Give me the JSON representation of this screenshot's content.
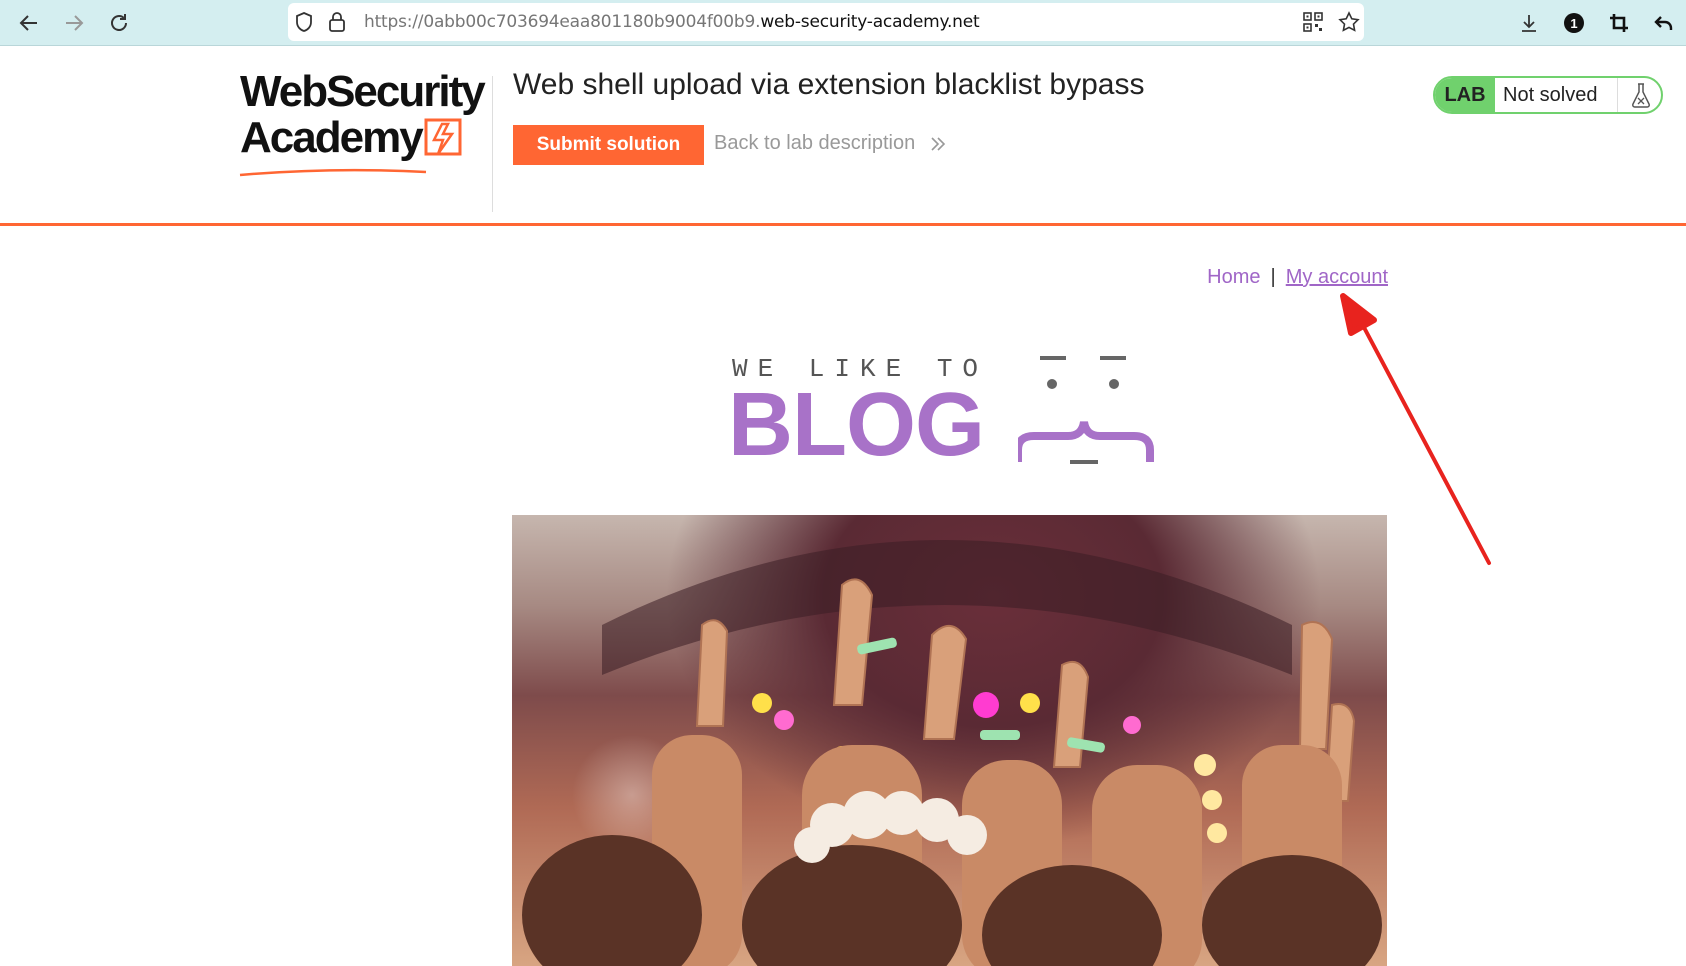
{
  "browser": {
    "url_prefix": "https://0abb00c703694eaa801180b9004f00b9.",
    "url_domain": "web-security-academy.net"
  },
  "lab": {
    "logo_line1": "WebSecurity",
    "logo_line2": "Academy",
    "title": "Web shell upload via extension blacklist bypass",
    "submit_label": "Submit solution",
    "back_label": "Back to lab description",
    "status_badge": "LAB",
    "status_text": "Not solved"
  },
  "blog": {
    "nav_home": "Home",
    "nav_separator": "|",
    "nav_account": "My account",
    "banner_top": "WE LIKE TO",
    "banner_main": "BLOG"
  },
  "colors": {
    "accent_orange": "#ff6633",
    "lab_green": "#70d16d",
    "blog_purple": "#a872c8",
    "link_purple": "#a066c7",
    "annotation_red": "#e8231e"
  },
  "icons": [
    "back-arrow-icon",
    "forward-arrow-icon",
    "reload-icon",
    "shield-icon",
    "lock-icon",
    "qr-code-icon",
    "star-icon",
    "download-icon",
    "profile-badge-icon",
    "crop-icon",
    "undo-icon",
    "flask-icon",
    "chevron-double-right-icon"
  ]
}
